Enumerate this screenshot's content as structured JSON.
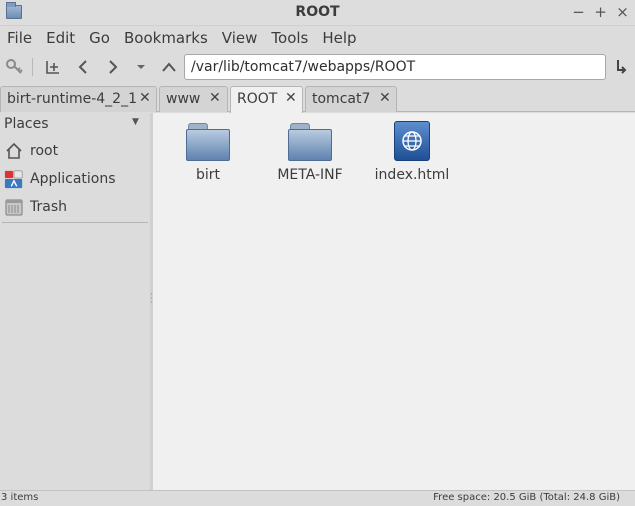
{
  "window": {
    "title": "ROOT"
  },
  "menu": [
    "File",
    "Edit",
    "Go",
    "Bookmarks",
    "View",
    "Tools",
    "Help"
  ],
  "toolbar": {
    "path": "/var/lib/tomcat7/webapps/ROOT"
  },
  "tabs": [
    {
      "label": "birt-runtime-4_2_1",
      "active": false
    },
    {
      "label": "www",
      "active": false
    },
    {
      "label": "ROOT",
      "active": true
    },
    {
      "label": "tomcat7",
      "active": false
    }
  ],
  "sidebar": {
    "header": "Places",
    "items": [
      {
        "label": "root",
        "icon": "home-icon"
      },
      {
        "label": "Applications",
        "icon": "applications-icon"
      },
      {
        "label": "Trash",
        "icon": "trash-icon"
      }
    ]
  },
  "files": [
    {
      "name": "birt",
      "type": "folder"
    },
    {
      "name": "META-INF",
      "type": "folder"
    },
    {
      "name": "index.html",
      "type": "html"
    }
  ],
  "status": {
    "items": "3 items",
    "free_space": "Free space: 20.5 GiB (Total: 24.8 GiB)"
  },
  "colors": {
    "folder": "#5f82ad",
    "html_file": "#1f4f95"
  }
}
